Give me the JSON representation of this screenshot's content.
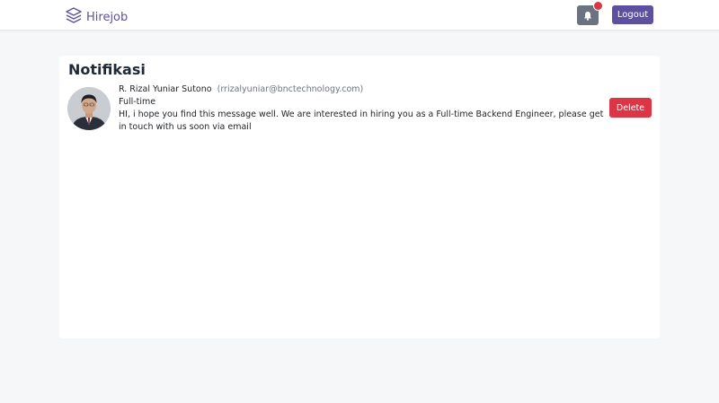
{
  "navbar": {
    "brand_label": "Hirejob",
    "brand_icon": "stack-layers-icon",
    "notification_icon": "bell-icon",
    "logout_label": "Logout",
    "colors": {
      "brand": "#5e50a1",
      "bell_button": "#6b7280",
      "badge": "#dc3545"
    }
  },
  "page": {
    "title": "Notifikasi"
  },
  "notifications": [
    {
      "sender_name": "R. Rizal Yuniar Sutono",
      "sender_email": "(rrizalyuniar@bnctechnology.com)",
      "job_type": "Full-time",
      "message": "HI, i hope you find this message well. We are interested in hiring you as a Full-time Backend Engineer, please get in touch with us soon via email",
      "delete_label": "Delete",
      "delete_color": "#dc3545"
    }
  ]
}
